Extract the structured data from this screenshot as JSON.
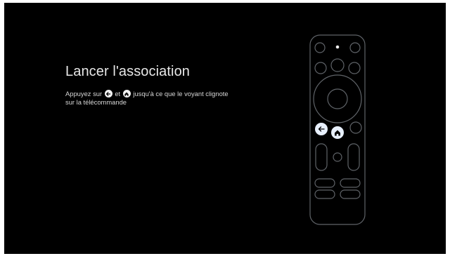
{
  "screen": {
    "title": "Lancer l'association",
    "instruction_before_back": "Appuyez sur",
    "instruction_between": "et",
    "instruction_after_home": "jusqu'à ce que le voyant clignote sur la télécommande"
  },
  "icons": {
    "back": "back-arrow-icon",
    "home": "home-icon"
  },
  "colors": {
    "background": "#000000",
    "outline": "#5f6368",
    "highlight": "#e8f0fe",
    "text": "#e8e8e8"
  }
}
